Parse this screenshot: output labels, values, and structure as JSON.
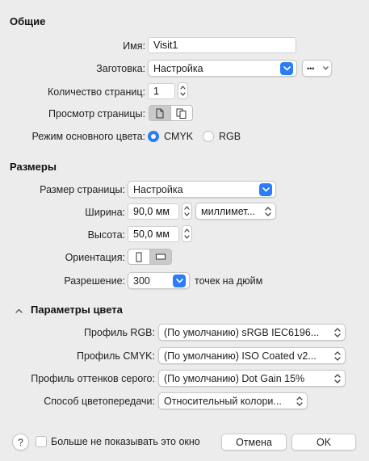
{
  "general": {
    "title": "Общие",
    "name_label": "Имя:",
    "name_value": "Visit1",
    "preset_label": "Заготовка:",
    "preset_value": "Настройка",
    "more_label": "•••",
    "pages_label": "Количество страниц:",
    "pages_value": "1",
    "preview_label": "Просмотр страницы:",
    "color_mode_label": "Режим основного цвета:",
    "cmyk_label": "CMYK",
    "rgb_label": "RGB",
    "color_mode_selected": "CMYK"
  },
  "sizes": {
    "title": "Размеры",
    "page_size_label": "Размер страницы:",
    "page_size_value": "Настройка",
    "width_label": "Ширина:",
    "width_value": "90,0 мм",
    "units_value": "миллимет...",
    "height_label": "Высота:",
    "height_value": "50,0 мм",
    "orientation_label": "Ориентация:",
    "orientation_selected": "landscape",
    "resolution_label": "Разрешение:",
    "resolution_value": "300",
    "resolution_unit": "точек на дюйм"
  },
  "color": {
    "title": "Параметры цвета",
    "rgb_profile_label": "Профиль RGB:",
    "rgb_profile_value": "(По умолчанию) sRGB IEC6196...",
    "cmyk_profile_label": "Профиль CMYK:",
    "cmyk_profile_value": "(По умолчанию) ISO Coated v2...",
    "gray_profile_label": "Профиль оттенков серого:",
    "gray_profile_value": "(По умолчанию) Dot Gain 15%",
    "intent_label": "Способ цветопередачи:",
    "intent_value": "Относительный колори..."
  },
  "footer": {
    "help_label": "?",
    "dont_show_label": "Больше не показывать это окно",
    "cancel_label": "Отмена",
    "ok_label": "OK"
  },
  "colors": {
    "accent": "#2a7df6",
    "background": "#ececec"
  }
}
